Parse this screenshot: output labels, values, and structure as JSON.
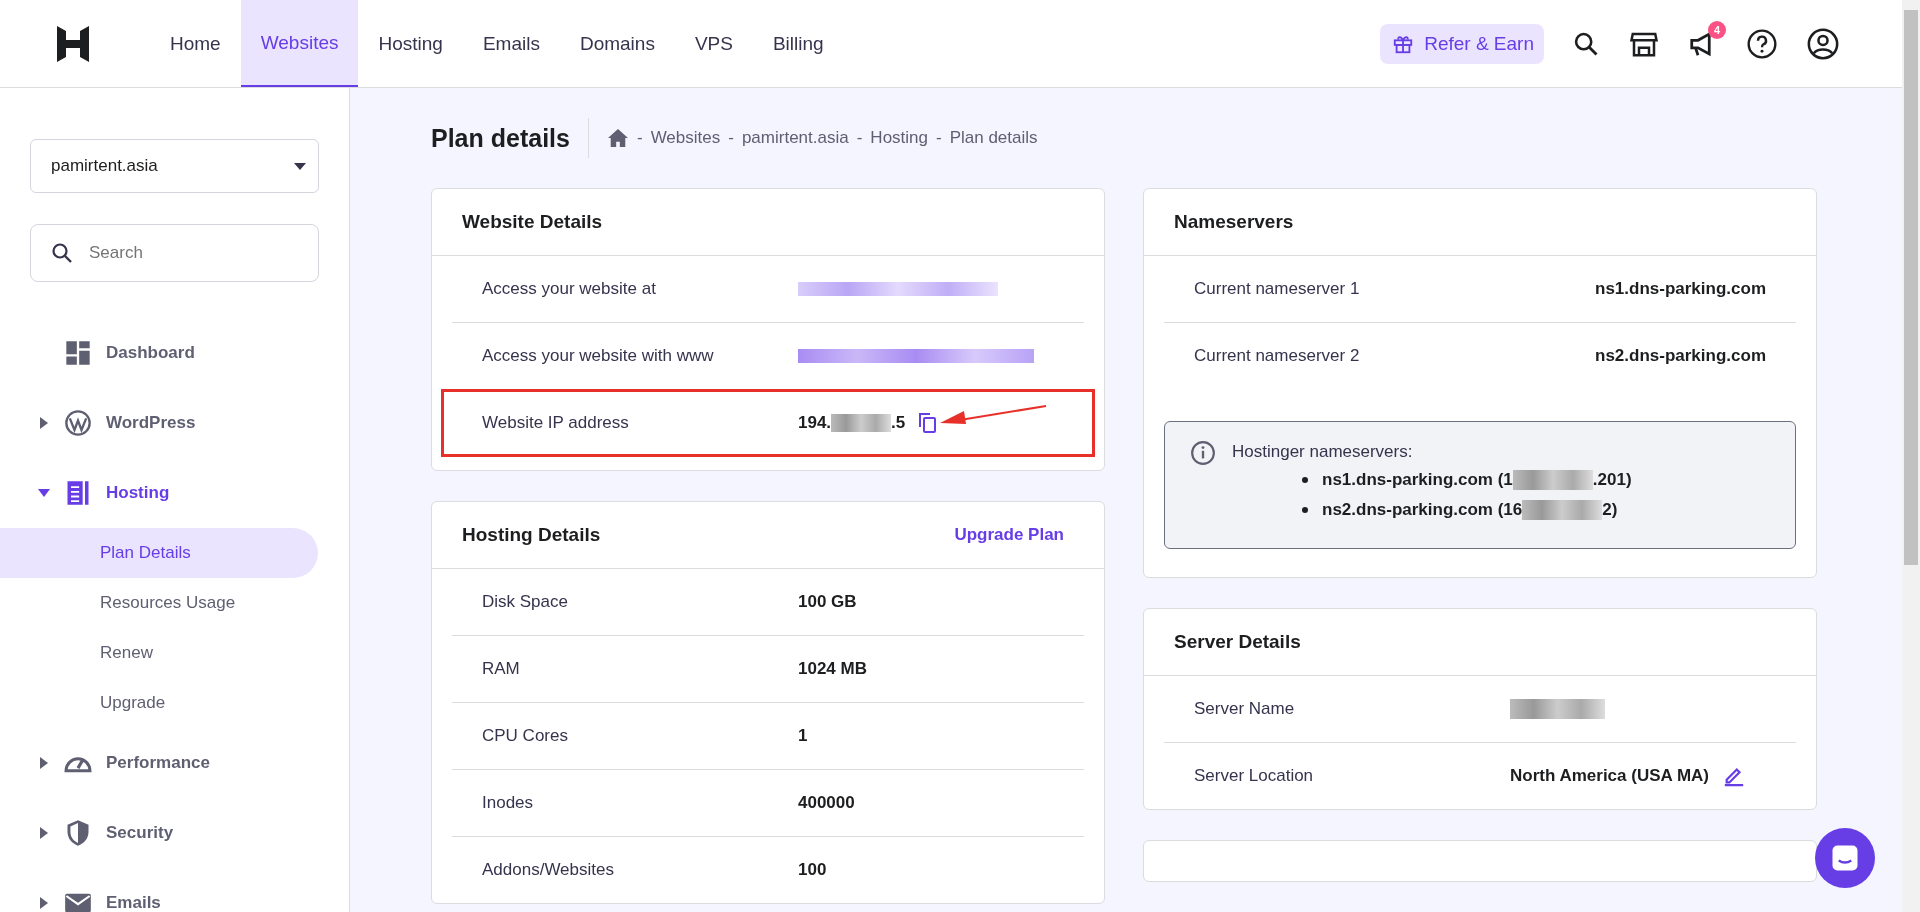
{
  "header": {
    "nav": [
      {
        "label": "Home",
        "selected": false
      },
      {
        "label": "Websites",
        "selected": true
      },
      {
        "label": "Hosting",
        "selected": false
      },
      {
        "label": "Emails",
        "selected": false
      },
      {
        "label": "Domains",
        "selected": false
      },
      {
        "label": "VPS",
        "selected": false
      },
      {
        "label": "Billing",
        "selected": false
      }
    ],
    "refer_button": "Refer & Earn",
    "notification_badge": "4"
  },
  "sidebar": {
    "site_select": "pamirtent.asia",
    "search": {
      "placeholder": "Search"
    },
    "items": [
      {
        "label": "Dashboard",
        "selected": false
      },
      {
        "label": "WordPress",
        "selected": false,
        "expanded": false
      },
      {
        "label": "Hosting",
        "selected": true,
        "expanded": true,
        "children": [
          {
            "label": "Plan Details",
            "selected": true
          },
          {
            "label": "Resources Usage",
            "selected": false
          },
          {
            "label": "Renew",
            "selected": false
          },
          {
            "label": "Upgrade",
            "selected": false
          }
        ]
      },
      {
        "label": "Performance",
        "selected": false,
        "expanded": false
      },
      {
        "label": "Security",
        "selected": false,
        "expanded": false
      },
      {
        "label": "Emails",
        "selected": false,
        "expanded": false
      }
    ]
  },
  "page_title": "Plan details",
  "breadcrumb_separator": "-",
  "breadcrumb": [
    "Websites",
    "pamirtent.asia",
    "Hosting",
    "Plan details"
  ],
  "website_details": {
    "title": "Website Details",
    "rows": [
      {
        "label": "Access your website at",
        "kind": "redacted_link",
        "highlighted": false
      },
      {
        "label": "Access your website with www",
        "kind": "redacted_link",
        "highlighted": false
      },
      {
        "label": "Website IP address",
        "kind": "ip",
        "value_start": "194.",
        "value_end": ".5",
        "highlighted": true
      }
    ]
  },
  "hosting_details": {
    "title": "Hosting Details",
    "action": "Upgrade Plan",
    "rows": [
      {
        "label": "Disk Space",
        "kind": "text",
        "value": "100 GB"
      },
      {
        "label": "RAM",
        "kind": "text",
        "value": "1024 MB"
      },
      {
        "label": "CPU Cores",
        "kind": "text",
        "value": "1"
      },
      {
        "label": "Inodes",
        "kind": "text",
        "value": "400000"
      },
      {
        "label": "Addons/Websites",
        "kind": "text",
        "value": "100"
      }
    ]
  },
  "nameservers": {
    "title": "Nameservers",
    "rows": [
      {
        "label": "Current nameserver 1",
        "value": "ns1.dns-parking.com"
      },
      {
        "label": "Current nameserver 2",
        "value": "ns2.dns-parking.com"
      }
    ],
    "note": {
      "title": "Hostinger nameservers:",
      "items": [
        {
          "start": "ns1.dns-parking.com (1",
          "end": ".201)"
        },
        {
          "start": "ns2.dns-parking.com (16",
          "end": "2)"
        }
      ]
    }
  },
  "server_details": {
    "title": "Server Details",
    "rows": [
      {
        "label": "Server Name",
        "kind": "redacted"
      },
      {
        "label": "Server Location",
        "kind": "editable",
        "value": "North America (USA MA)"
      }
    ]
  }
}
